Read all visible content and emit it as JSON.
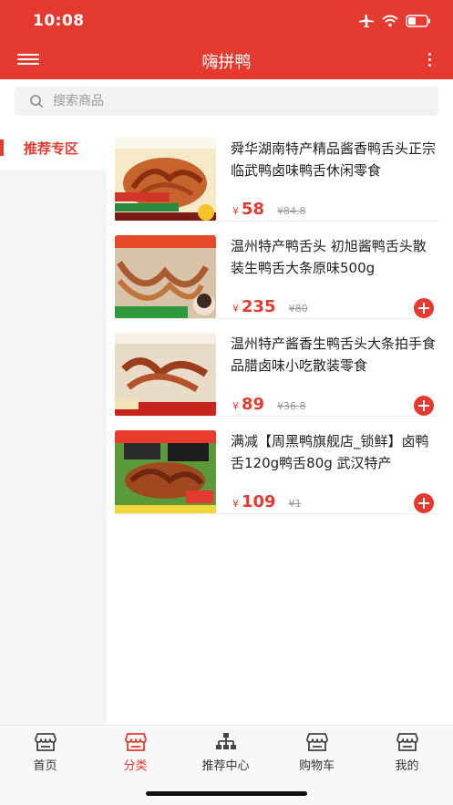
{
  "status_bar": {
    "time": "10:08",
    "icons": [
      "airplane-icon",
      "wifi-icon",
      "battery-icon"
    ]
  },
  "nav": {
    "title": "嗨拼鸭",
    "menu_icon": "hamburger-menu-icon",
    "more_icon": "more-vertical-icon"
  },
  "search": {
    "placeholder": "搜索商品",
    "value": ""
  },
  "sidebar": {
    "items": [
      {
        "label": "推荐专区",
        "selected": true
      }
    ]
  },
  "products": [
    {
      "name": "舜华湖南特产精品酱香鸭舌头正宗临武鸭卤味鸭舌休闲零食",
      "currency": "¥",
      "price": "58",
      "original_price": "¥84.8",
      "has_add": false
    },
    {
      "name": "温州特产鸭舌头 初旭酱鸭舌头散装生鸭舌大条原味500g",
      "currency": "¥",
      "price": "235",
      "original_price": "¥80",
      "has_add": true
    },
    {
      "name": "温州特产酱香生鸭舌头大条拍手食品腊卤味小吃散装零食",
      "currency": "¥",
      "price": "89",
      "original_price": "¥36.8",
      "has_add": true
    },
    {
      "name": "满减【周黑鸭旗舰店_锁鲜】卤鸭舌120g鸭舌80g 武汉特产",
      "currency": "¥",
      "price": "109",
      "original_price": "¥1",
      "has_add": true
    }
  ],
  "tabbar": {
    "items": [
      {
        "label": "首页",
        "icon": "store-icon",
        "active": false
      },
      {
        "label": "分类",
        "icon": "store-icon",
        "active": true
      },
      {
        "label": "推荐中心",
        "icon": "sitemap-icon",
        "active": false
      },
      {
        "label": "购物车",
        "icon": "store-icon",
        "active": false
      },
      {
        "label": "我的",
        "icon": "store-icon",
        "active": false
      }
    ]
  },
  "colors": {
    "accent": "#e53a2f",
    "sidebar_bg": "#f4f4f4",
    "search_bg": "#f2f2f2",
    "tabbar_bg": "#f8f8f8"
  }
}
